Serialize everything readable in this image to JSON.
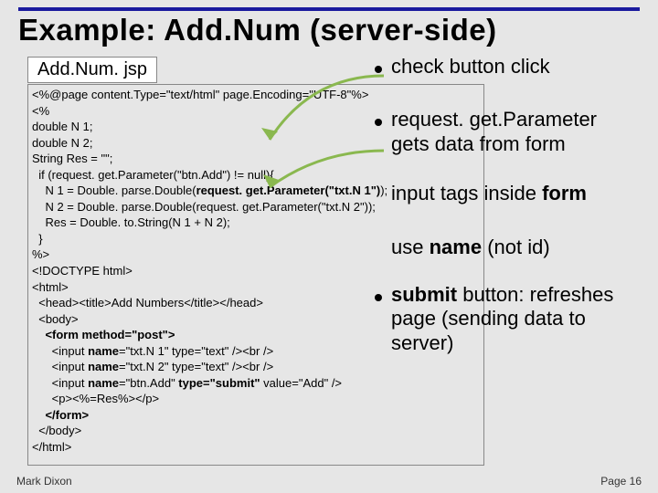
{
  "title": "Example: Add.Num (server-side)",
  "filename": "Add.Num. jsp",
  "code_lines": [
    {
      "t": "<%@page content.Type=\"text/html\" page.Encoding=\"UTF-8\"%>",
      "b": false
    },
    {
      "t": "<%",
      "b": false
    },
    {
      "t": "double N 1;",
      "b": false
    },
    {
      "t": "double N 2;",
      "b": false
    },
    {
      "t": "String Res = \"\";",
      "b": false
    },
    {
      "t": "  if (request. get.Parameter(\"btn.Add\") != null){",
      "b": false
    },
    {
      "t": "    N 1 = Double. parse.Double(",
      "b": false,
      "mid": "request. get.Parameter(\"txt.N 1\")",
      "midb": true,
      "after": ");"
    },
    {
      "t": "    N 2 = Double. parse.Double(request. get.Parameter(\"txt.N 2\"));",
      "b": false
    },
    {
      "t": "    Res = Double. to.String(N 1 + N 2);",
      "b": false
    },
    {
      "t": "  }",
      "b": false
    },
    {
      "t": "%>",
      "b": false
    },
    {
      "t": "<!DOCTYPE html>",
      "b": false
    },
    {
      "t": "<html>",
      "b": false
    },
    {
      "t": "  <head><title>Add Numbers</title></head>",
      "b": false
    },
    {
      "t": "  <body>",
      "b": false
    },
    {
      "t": "    <form method=\"post\">",
      "b": true
    },
    {
      "t": "      <input ",
      "b": false,
      "mid": "name",
      "midb": true,
      "after": "=\"txt.N 1\" type=\"text\" /><br />"
    },
    {
      "t": "      <input ",
      "b": false,
      "mid": "name",
      "midb": true,
      "after": "=\"txt.N 2\" type=\"text\" /><br />"
    },
    {
      "t": "      <input ",
      "b": false,
      "mid": "name",
      "midb": true,
      "after": "=\"btn.Add\" ",
      "mid2": "type=\"submit\"",
      "mid2b": true,
      "after2": " value=\"Add\" />"
    },
    {
      "t": "      <p><%=Res%></p>",
      "b": false
    },
    {
      "t": "    </form>",
      "b": true
    },
    {
      "t": "  </body>",
      "b": false
    },
    {
      "t": "</html>",
      "b": false
    }
  ],
  "bullets": {
    "b1": "check button click",
    "b2_a": "request. get.Parameter",
    "b2_b": "gets data from form",
    "b3_a": "input tags inside ",
    "b3_b": "form",
    "b4_a": "use ",
    "b4_b": "name",
    "b4_c": " (not id)",
    "b5_a": "submit",
    "b5_b": " button: refreshes page (sending data to server)"
  },
  "footer": {
    "left": "Mark Dixon",
    "right": "Page 16"
  }
}
